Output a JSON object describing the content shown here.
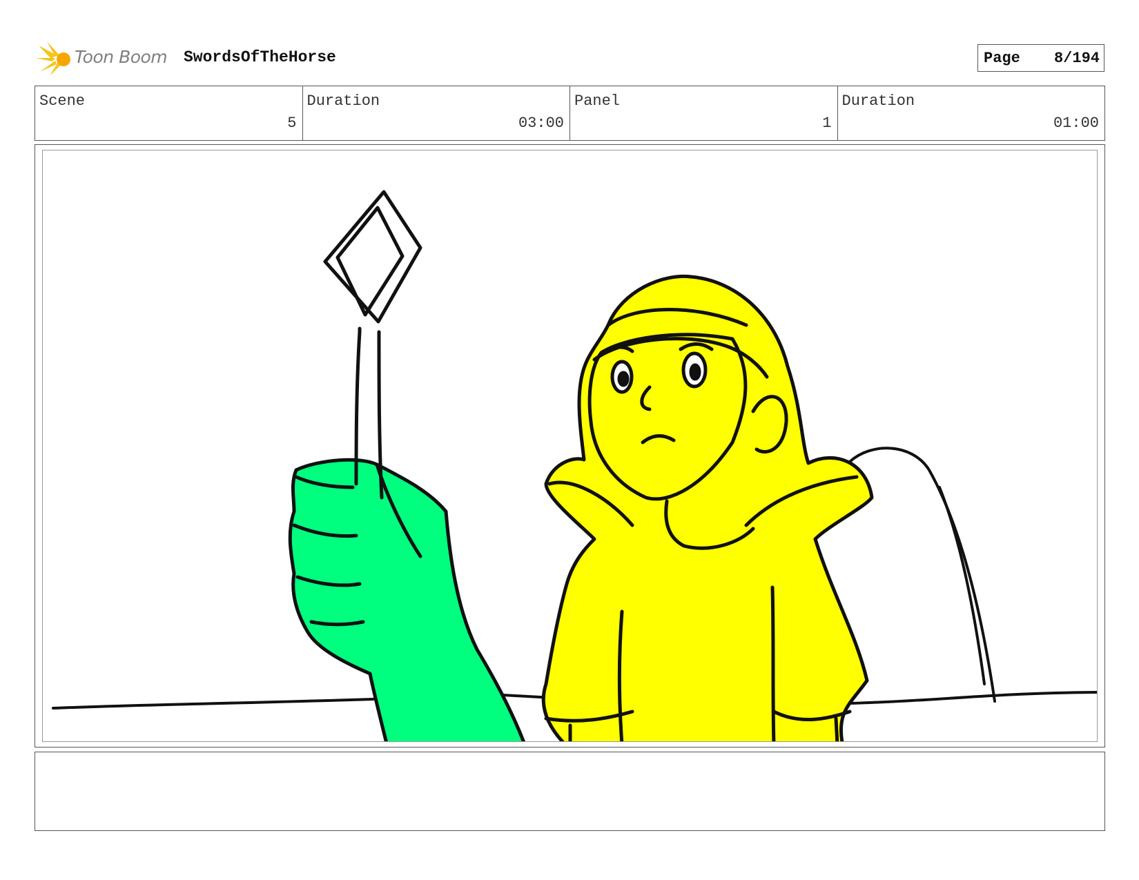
{
  "header": {
    "logo_text": "Toon Boom",
    "project_title": "SwordsOfTheHorse",
    "page_label": "Page",
    "page_value": "8/194"
  },
  "info": {
    "scene_label": "Scene",
    "scene_value": "5",
    "scene_duration_label": "Duration",
    "scene_duration_value": "03:00",
    "panel_label": "Panel",
    "panel_value": "1",
    "panel_duration_label": "Duration",
    "panel_duration_value": "01:00"
  },
  "colors": {
    "logo_accent": "#f5c518",
    "character_fill": "#ffff00",
    "hand_fill": "#00ff7f",
    "ink": "#111111"
  },
  "notes": {
    "text": ""
  }
}
